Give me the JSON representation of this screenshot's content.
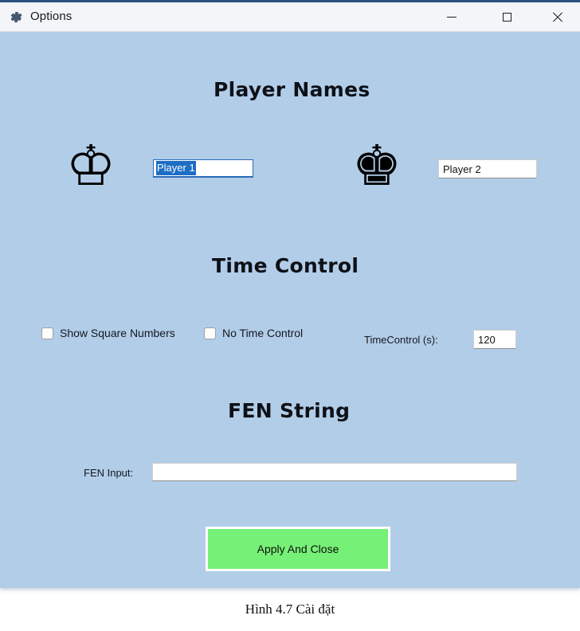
{
  "window": {
    "title": "Options",
    "icon": "gear-icon",
    "background_color": "#b2cde8",
    "titlebar_color": "#f3f5f8",
    "accent_color": "#2e5180",
    "controls": {
      "minimize": "minimize-icon",
      "maximize": "maximize-icon",
      "close": "close-icon"
    }
  },
  "sections": {
    "player_names": {
      "heading": "Player Names",
      "white": {
        "piece_icon": "white-king-icon",
        "piece_glyph": "♔",
        "input_value": "Player 1",
        "input_placeholder": "",
        "selected": true,
        "focused": true,
        "selection_color": "#1c6ec4",
        "focus_border_color": "#2b6cb8"
      },
      "black": {
        "piece_icon": "black-king-icon",
        "piece_glyph": "♚",
        "input_value": "Player 2",
        "input_placeholder": "",
        "selected": false,
        "focused": false
      }
    },
    "time_control": {
      "heading": "Time Control",
      "checkboxes": [
        {
          "name": "show-square-numbers",
          "label": "Show Square Numbers",
          "checked": false
        },
        {
          "name": "no-time-control",
          "label": "No Time Control",
          "checked": false
        }
      ],
      "time_field": {
        "label": "TimeControl (s):",
        "value": "120",
        "placeholder": ""
      }
    },
    "fen_string": {
      "heading": "FEN String",
      "input": {
        "label": "FEN Input:",
        "value": "",
        "placeholder": ""
      }
    }
  },
  "actions": {
    "apply": {
      "label": "Apply And Close",
      "background_color": "#77f077",
      "border_color": "#ffffff"
    }
  },
  "caption": "Hình 4.7 Cài đặt"
}
